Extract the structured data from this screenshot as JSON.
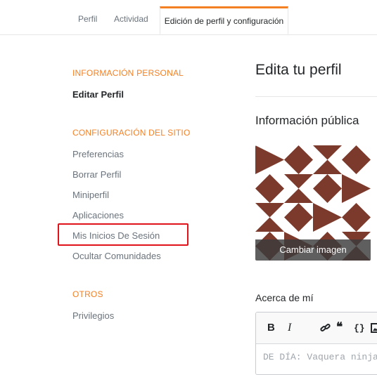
{
  "tabs": {
    "perfil": "Perfil",
    "actividad": "Actividad",
    "edicion": "Edición de perfil y configuración"
  },
  "sidebar": {
    "personal_header": "INFORMACIÓN PERSONAL",
    "personal_items": [
      "Editar Perfil"
    ],
    "site_header": "CONFIGURACIÓN DEL SITIO",
    "site_items": [
      "Preferencias",
      "Borrar Perfil",
      "Miniperfil",
      "Aplicaciones",
      "Mis Inicios De Sesión",
      "Ocultar Comunidades"
    ],
    "others_header": "OTROS",
    "others_items": [
      "Privilegios"
    ]
  },
  "main": {
    "title": "Edita tu perfil",
    "public_info_title": "Información pública",
    "change_image": "Cambiar imagen",
    "about_label": "Acerca de mí",
    "about_placeholder": "DE DÍA: Vaquera ninja"
  },
  "colors": {
    "accent": "#f48024",
    "identicon": "#7c3a2c",
    "highlight": "#e0121a"
  },
  "icons": {
    "bold": "bold-icon",
    "italic": "italic-icon",
    "link": "link-icon",
    "quote": "quote-icon",
    "code": "code-icon",
    "image": "image-icon"
  }
}
